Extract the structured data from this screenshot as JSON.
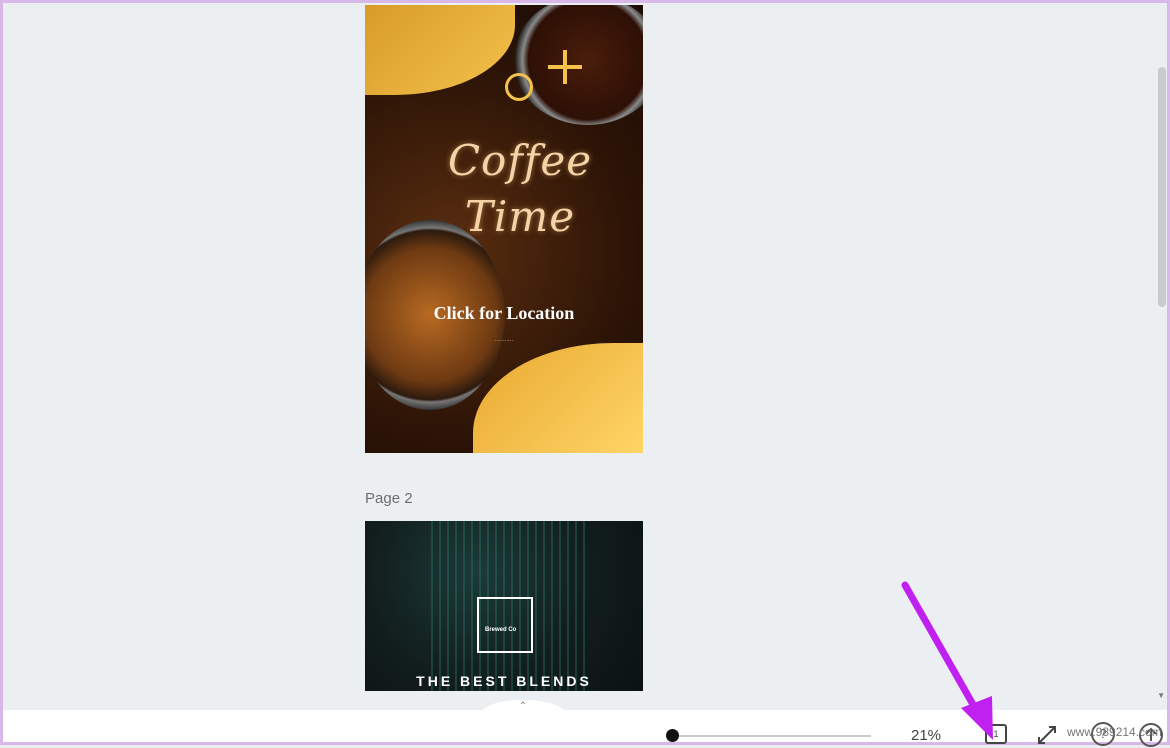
{
  "canvas": {
    "page1": {
      "title": "Coffee Time",
      "location_text": "Click for Location",
      "tiny_text": "..........."
    },
    "page2_label": "Page 2",
    "page2": {
      "frame_text": "Brewed Co",
      "headline": "THE BEST BLENDS"
    }
  },
  "footer": {
    "collapse_glyph": "⌃",
    "zoom_value": "21%",
    "pages_glyph": "1",
    "help_glyph": "?"
  },
  "watermark": "www.989214.com",
  "colors": {
    "accent_gold": "#f5c24b",
    "annotation_arrow": "#c020f0",
    "background": "#eceff1"
  }
}
